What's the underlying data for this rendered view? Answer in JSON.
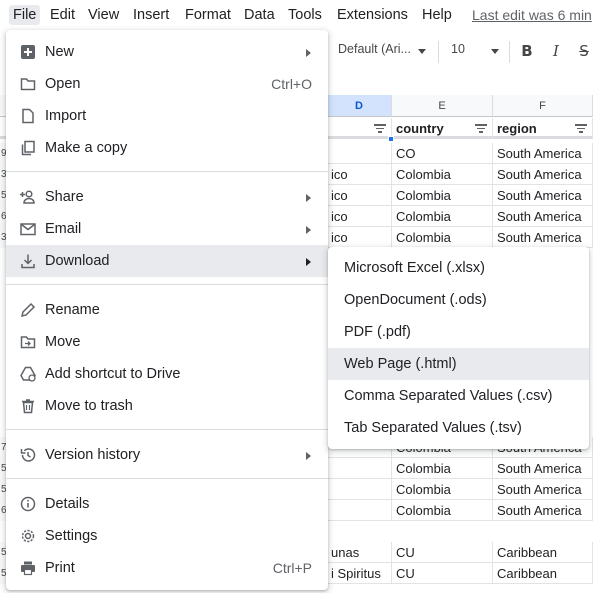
{
  "menubar": {
    "items": [
      "File",
      "Edit",
      "View",
      "Insert",
      "Format",
      "Data",
      "Tools",
      "Extensions",
      "Help"
    ],
    "active": "File",
    "last_edit": "Last edit was 6 min"
  },
  "toolbar": {
    "font": "Default (Ari...",
    "font_size": "10",
    "bold": "B",
    "italic": "I",
    "strike": "S"
  },
  "sheet": {
    "columns": [
      "D",
      "E",
      "F"
    ],
    "selected_column": "D",
    "header_row": {
      "d": "",
      "country": "country",
      "region": "region"
    },
    "rows": [
      {
        "num": "9",
        "d": "",
        "country": "CO",
        "region": "South America"
      },
      {
        "num": "3",
        "d": "ico",
        "country": "Colombia",
        "region": "South America"
      },
      {
        "num": "5",
        "d": "ico",
        "country": "Colombia",
        "region": "South America"
      },
      {
        "num": "6",
        "d": "ico",
        "country": "Colombia",
        "region": "South America"
      },
      {
        "num": "3",
        "d": "ico",
        "country": "Colombia",
        "region": "South America"
      },
      {
        "num": "7",
        "d": "",
        "country": "Colombia",
        "region": "South America"
      },
      {
        "num": "5",
        "d": "",
        "country": "Colombia",
        "region": "South America"
      },
      {
        "num": "5",
        "d": "",
        "country": "Colombia",
        "region": "South America"
      },
      {
        "num": "6",
        "d": "",
        "country": "Colombia",
        "region": "South America"
      },
      {
        "num": "5",
        "d": "unas",
        "country": "CU",
        "region": "Caribbean"
      },
      {
        "num": "5",
        "d": "i Spiritus",
        "country": "CU",
        "region": "Caribbean"
      }
    ]
  },
  "file_menu": {
    "items": [
      {
        "label": "New",
        "icon": "plus-square-icon",
        "submenu": true
      },
      {
        "label": "Open",
        "icon": "folder-icon",
        "shortcut": "Ctrl+O"
      },
      {
        "label": "Import",
        "icon": "file-icon"
      },
      {
        "label": "Make a copy",
        "icon": "copy-icon"
      },
      {
        "label": "Share",
        "icon": "person-add-icon",
        "submenu": true
      },
      {
        "label": "Email",
        "icon": "mail-icon",
        "submenu": true
      },
      {
        "label": "Download",
        "icon": "download-icon",
        "submenu": true,
        "hover": true
      },
      {
        "label": "Rename",
        "icon": "pencil-icon"
      },
      {
        "label": "Move",
        "icon": "move-folder-icon"
      },
      {
        "label": "Add shortcut to Drive",
        "icon": "drive-shortcut-icon"
      },
      {
        "label": "Move to trash",
        "icon": "trash-icon"
      },
      {
        "label": "Version history",
        "icon": "history-icon",
        "submenu": true
      },
      {
        "label": "Details",
        "icon": "info-icon"
      },
      {
        "label": "Settings",
        "icon": "gear-icon"
      },
      {
        "label": "Print",
        "icon": "printer-icon",
        "shortcut": "Ctrl+P"
      }
    ]
  },
  "download_submenu": {
    "items": [
      {
        "label": "Microsoft Excel (.xlsx)"
      },
      {
        "label": "OpenDocument (.ods)"
      },
      {
        "label": "PDF (.pdf)"
      },
      {
        "label": "Web Page (.html)",
        "hover": true
      },
      {
        "label": "Comma Separated Values (.csv)"
      },
      {
        "label": "Tab Separated Values (.tsv)"
      }
    ]
  },
  "colors": {
    "hover_bg": "#e8eaed",
    "selected_col_bg": "#d3e3fd",
    "accent": "#1a73e8"
  }
}
